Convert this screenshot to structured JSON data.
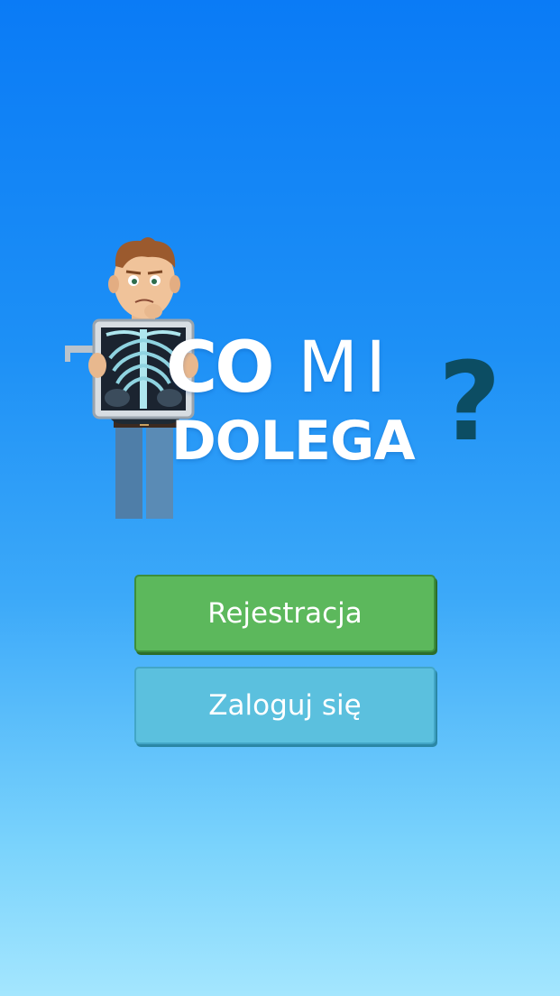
{
  "logo": {
    "word_co": "CO",
    "word_mi": "MI",
    "word_dolega": "DOLEGA",
    "question_mark": "?"
  },
  "buttons": {
    "register_label": "Rejestracja",
    "login_label": "Zaloguj się"
  },
  "colors": {
    "background_top": "#0a7bf6",
    "background_bottom": "#a4e6fe",
    "register_button": "#5cb85c",
    "login_button": "#5bc0de",
    "question_mark": "#0c4d63"
  },
  "icons": {
    "mascot": "doctor-with-xray-icon"
  }
}
